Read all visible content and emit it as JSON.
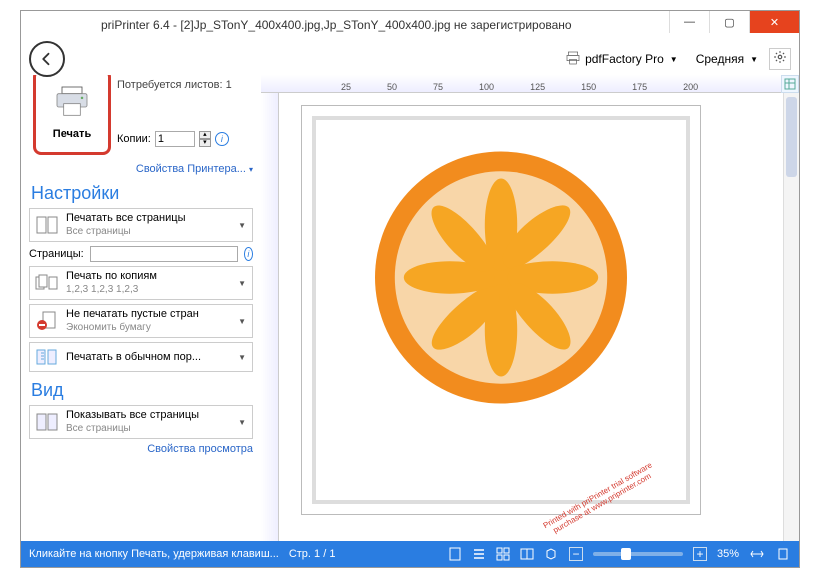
{
  "window": {
    "title": "priPrinter 6.4 - [2]Jp_STonY_400x400.jpg,Jp_STonY_400x400.jpg не зарегистрировано"
  },
  "topbar": {
    "printer_label": "pdfFactory Pro",
    "quality_label": "Средняя"
  },
  "print": {
    "button_label": "Печать",
    "sheets_label": "Потребуется листов: 1",
    "copies_label": "Копии:",
    "copies_value": "1",
    "printer_props_link": "Свойства Принтера..."
  },
  "settings": {
    "header": "Настройки",
    "opt_allpages_title": "Печатать все страницы",
    "opt_allpages_sub": "Все страницы",
    "pages_label": "Страницы:",
    "pages_value": "",
    "opt_copies_title": "Печать по копиям",
    "opt_copies_sub": "1,2,3  1,2,3  1,2,3",
    "opt_noempty_title": "Не печатать пустые стран",
    "opt_noempty_sub": "Экономить бумагу",
    "opt_normal_title": "Печатать в обычном пор..."
  },
  "view": {
    "header": "Вид",
    "opt_showall_title": "Показывать все страницы",
    "opt_showall_sub": "Все страницы",
    "view_props_link": "Свойства просмотра"
  },
  "ruler": {
    "ticks": [
      "25",
      "50",
      "75",
      "100",
      "125",
      "150",
      "175",
      "200"
    ]
  },
  "watermark": {
    "line1": "Printed with priPrinter trial software",
    "line2": "purchase at www.priprinter.com"
  },
  "status": {
    "msg": "Кликайте на кнопку Печать, удерживая клавиш...",
    "page": "Стр. 1 / 1",
    "zoom": "35%"
  }
}
